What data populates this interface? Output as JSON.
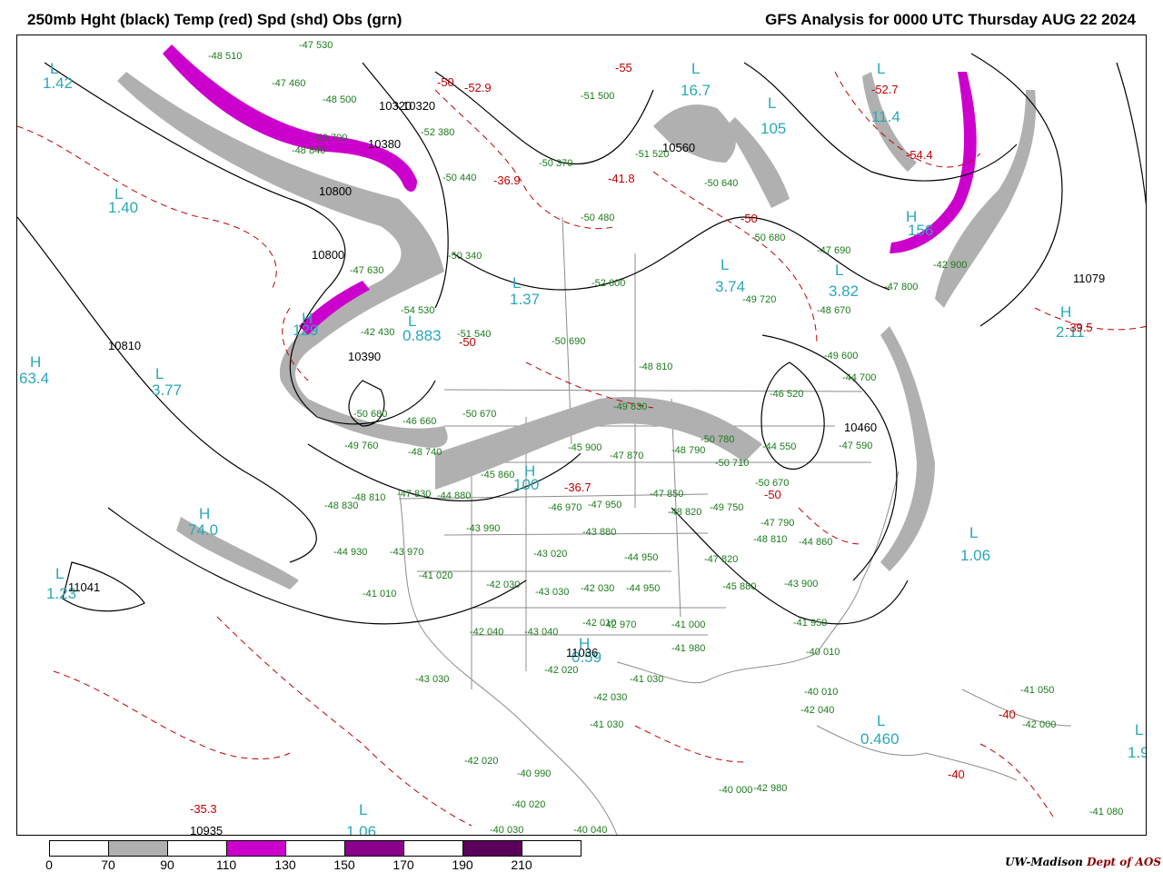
{
  "header": {
    "left_title": "250mb Hght (black) Temp (red) Spd (shd) Obs (grn)",
    "right_title": "GFS Analysis for 0000 UTC Thursday  AUG 22 2024"
  },
  "legend": {
    "segments": [
      {
        "color": "#ffffff"
      },
      {
        "color": "#b0b0b0"
      },
      {
        "color": "#ffffff"
      },
      {
        "color": "#cc00cc"
      },
      {
        "color": "#ffffff"
      },
      {
        "color": "#8a008a"
      },
      {
        "color": "#ffffff"
      },
      {
        "color": "#5a005a"
      },
      {
        "color": "#ffffff"
      }
    ],
    "ticks": [
      "0",
      "70",
      "90",
      "110",
      "130",
      "150",
      "170",
      "190",
      "210"
    ]
  },
  "credit": {
    "org": "UW-Madison",
    "dept": "Dept of AOS"
  },
  "colors": {
    "height_contour": "#000000",
    "temp_contour": "#c00000",
    "speed_70_90": "#b0b0b0",
    "speed_110_130": "#cc00cc",
    "obs": "#1a7a1a",
    "extrema_label": "#29a8b8",
    "geography": "#8c8c8c"
  },
  "map_labels": {
    "cyan": [
      "L",
      "1.42",
      "L",
      "1.40",
      "H",
      "63.4",
      "L",
      "3.77",
      "H",
      "74.0",
      "L",
      "1.23",
      "L",
      "1.37",
      "L",
      "0.883",
      "L",
      "16.7",
      "L",
      "105",
      "L",
      "11.4",
      "L",
      "3.74",
      "L",
      "3.82",
      "H",
      "156",
      "H",
      "2.11",
      "L",
      "1.06",
      "L",
      "0.460",
      "L",
      "1.9",
      "L",
      "1.06",
      "H",
      "0.59",
      "H",
      "129",
      "H",
      "100"
    ],
    "heights": [
      "10320",
      "10320",
      "10380",
      "10800",
      "10800",
      "10810",
      "10390",
      "10560",
      "11079",
      "11041",
      "11036",
      "10935",
      "10460"
    ],
    "temps_red": [
      "-52.9",
      "-50",
      "-55",
      "-36.9",
      "-41.8",
      "-50",
      "-52.7",
      "-54.4",
      "-39.5",
      "-36.7",
      "-50",
      "-50",
      "-35.3",
      "-40",
      "-40"
    ],
    "obs": [
      "-48 510",
      "-47 530",
      "-47 460",
      "-48 500",
      "-51 500",
      "-53 700",
      "-48 840",
      "-52 380",
      "-50 440",
      "-50 370",
      "-51 520",
      "-50 640",
      "-50 680",
      "-47 690",
      "-42 900",
      "-47 800",
      "-48 670",
      "-50 480",
      "-54 530",
      "-50 340",
      "-47 630",
      "-42 430",
      "-51 540",
      "-50 690",
      "-49 720",
      "-52 600",
      "-48 810",
      "-50 680",
      "-50 670",
      "-46 660",
      "-49 760",
      "-48 740",
      "-45 860",
      "-49 830",
      "-45 900",
      "-47 870",
      "-48 790",
      "-50 780",
      "-50 710",
      "-44 550",
      "-46 520",
      "-44 700",
      "-49 600",
      "-47 590",
      "-48 810",
      "-47 830",
      "-44 880",
      "-46 970",
      "-47 950",
      "-47 850",
      "-48 820",
      "-49 750",
      "-50 670",
      "-47 790",
      "-48 810",
      "-44 860",
      "-48 830",
      "-44 930",
      "-43 970",
      "-43 990",
      "-43 020",
      "-43 880",
      "-44 950",
      "-47 820",
      "-45 880",
      "-43 900",
      "-41 950",
      "-41 010",
      "-41 020",
      "-42 030",
      "-43 030",
      "-42 030",
      "-44 950",
      "-42 040",
      "-42 010",
      "-42 970",
      "-41 000",
      "-41 980",
      "-40 010",
      "-40 010",
      "-42 040",
      "-43 030",
      "-43 040",
      "-42 020",
      "-42 030",
      "-41 030",
      "-41 030",
      "-42 020",
      "-40 990",
      "-40 020",
      "-40 030",
      "-40 040",
      "-40 000",
      "-42 980",
      "-42 000",
      "-41 050",
      "-41 080"
    ]
  }
}
